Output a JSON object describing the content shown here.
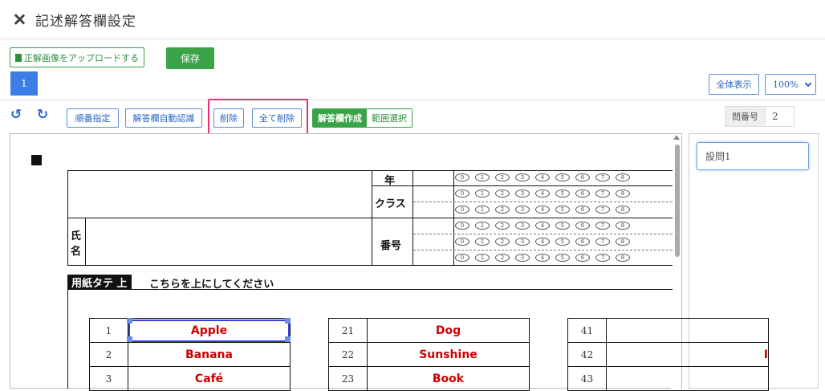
{
  "window": {
    "title": "記述解答欄設定"
  },
  "toolbar": {
    "upload_label": "正解画像をアップロードする",
    "save_label": "保存",
    "page_tab": "1",
    "view_all_label": "全体表示",
    "zoom_value": "100%"
  },
  "edit_toolbar": {
    "order_label": "順番指定",
    "auto_detect_label": "解答欄自動認識",
    "delete_label": "削除",
    "delete_all_label": "全て削除",
    "create_label": "解答欄作成",
    "range_label": "範囲選択",
    "question_number_label": "問番号",
    "question_number_value": "2"
  },
  "side_panel": {
    "question_value": "設問1"
  },
  "sheet": {
    "header": {
      "year": "年",
      "class": "クラス",
      "number": "番号",
      "name_chars": [
        "氏",
        "名"
      ],
      "bubble_digits": [
        "0",
        "1",
        "2",
        "3",
        "4",
        "5",
        "6",
        "7",
        "8"
      ]
    },
    "band_label": "用紙タテ 上",
    "band_text": "こちらを上にしてください",
    "columns": [
      {
        "rows": [
          {
            "n": "1",
            "w": "Apple"
          },
          {
            "n": "2",
            "w": "Banana"
          },
          {
            "n": "3",
            "w": "Café"
          }
        ]
      },
      {
        "rows": [
          {
            "n": "21",
            "w": "Dog"
          },
          {
            "n": "22",
            "w": "Sunshine"
          },
          {
            "n": "23",
            "w": "Book"
          }
        ]
      },
      {
        "rows": [
          {
            "n": "41",
            "w": ""
          },
          {
            "n": "42",
            "w": "I"
          },
          {
            "n": "43",
            "w": ""
          }
        ]
      }
    ]
  },
  "colors": {
    "primary_blue": "#3d7ee6",
    "green": "#3aa347",
    "highlight_pink": "#e6307a",
    "answer_red": "#c00000"
  }
}
